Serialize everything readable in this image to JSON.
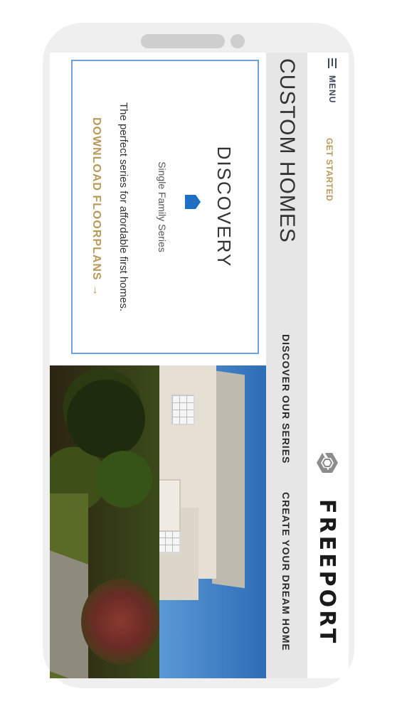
{
  "brand": {
    "name": "FREEPORT",
    "icon": "freeport-logo-mark"
  },
  "header": {
    "menu_label": "MENU",
    "menu_icon": "hamburger-icon",
    "get_started_label": "GET STARTED"
  },
  "subnav": {
    "section_title": "CUSTOM HOMES",
    "links": [
      {
        "label": "DISCOVER OUR SERIES"
      },
      {
        "label": "CREATE YOUR DREAM HOME"
      }
    ]
  },
  "card": {
    "title": "DISCOVERY",
    "icon": "house-pin-icon",
    "subtitle": "Single Family Series",
    "description": "The perfect series for affordable first homes.",
    "link_label": "DOWNLOAD FLOORPLANS →"
  },
  "colors": {
    "accent_gold": "#b89a5a",
    "accent_blue": "#6ba3d6",
    "icon_blue": "#1f6fc4",
    "subnav_bg": "#e6e6e6",
    "phone_frame": "#efefef"
  }
}
